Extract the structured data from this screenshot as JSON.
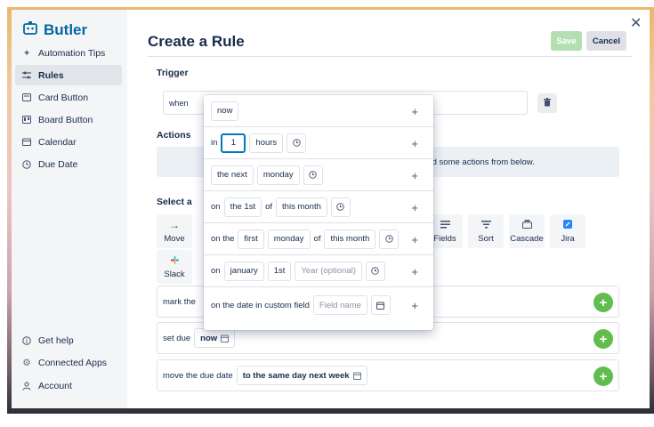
{
  "sidebar": {
    "brand": "Butler",
    "items": [
      {
        "label": "Automation Tips",
        "icon": "sparkle-icon"
      },
      {
        "label": "Rules",
        "icon": "sliders-icon",
        "active": true
      },
      {
        "label": "Card Button",
        "icon": "card-icon"
      },
      {
        "label": "Board Button",
        "icon": "board-icon"
      },
      {
        "label": "Calendar",
        "icon": "calendar-icon"
      },
      {
        "label": "Due Date",
        "icon": "clock-icon"
      }
    ],
    "footer": [
      {
        "label": "Get help",
        "icon": "info-icon"
      },
      {
        "label": "Connected Apps",
        "icon": "gear-icon"
      },
      {
        "label": "Account",
        "icon": "user-icon"
      }
    ]
  },
  "header": {
    "title": "Create a Rule",
    "save_label": "Save",
    "cancel_label": "Cancel"
  },
  "trigger": {
    "label": "Trigger",
    "when_text": "when"
  },
  "actions": {
    "label": "Actions",
    "empty_text": "Add some actions from below."
  },
  "select_action": {
    "label": "Select a",
    "tiles": [
      {
        "label": "Move",
        "icon": "arrow-right-icon"
      },
      {
        "label": "Fields",
        "icon": "fields-icon"
      },
      {
        "label": "Sort",
        "icon": "sort-icon"
      },
      {
        "label": "Cascade",
        "icon": "cascade-icon"
      },
      {
        "label": "Jira",
        "icon": "jira-icon"
      },
      {
        "label": "Slack",
        "icon": "slack-icon"
      }
    ],
    "rows": [
      {
        "prefix": "mark the"
      },
      {
        "prefix": "set due",
        "value": "now"
      },
      {
        "prefix": "move the due date",
        "value": "to the same day next week"
      }
    ]
  },
  "popup": {
    "rows": [
      {
        "options": [
          "now"
        ]
      },
      {
        "prefix": "in",
        "input_value": "1",
        "unit": "hours"
      },
      {
        "prefix": "the next",
        "day": "monday"
      },
      {
        "prefix": "on",
        "day": "the 1st",
        "middle": "of",
        "period": "this month"
      },
      {
        "prefix": "on the",
        "ordinal": "first",
        "day": "monday",
        "middle": "of",
        "period": "this month"
      },
      {
        "prefix": "on",
        "month": "january",
        "day": "1st",
        "year_placeholder": "Year (optional)"
      },
      {
        "prefix": "on the date in custom field",
        "field_placeholder": "Field name"
      }
    ]
  },
  "colors": {
    "brand": "#0067a3",
    "save_disabled": "#b3dfb3",
    "add_green": "#61bd4f",
    "focus_blue": "#0079bf"
  }
}
